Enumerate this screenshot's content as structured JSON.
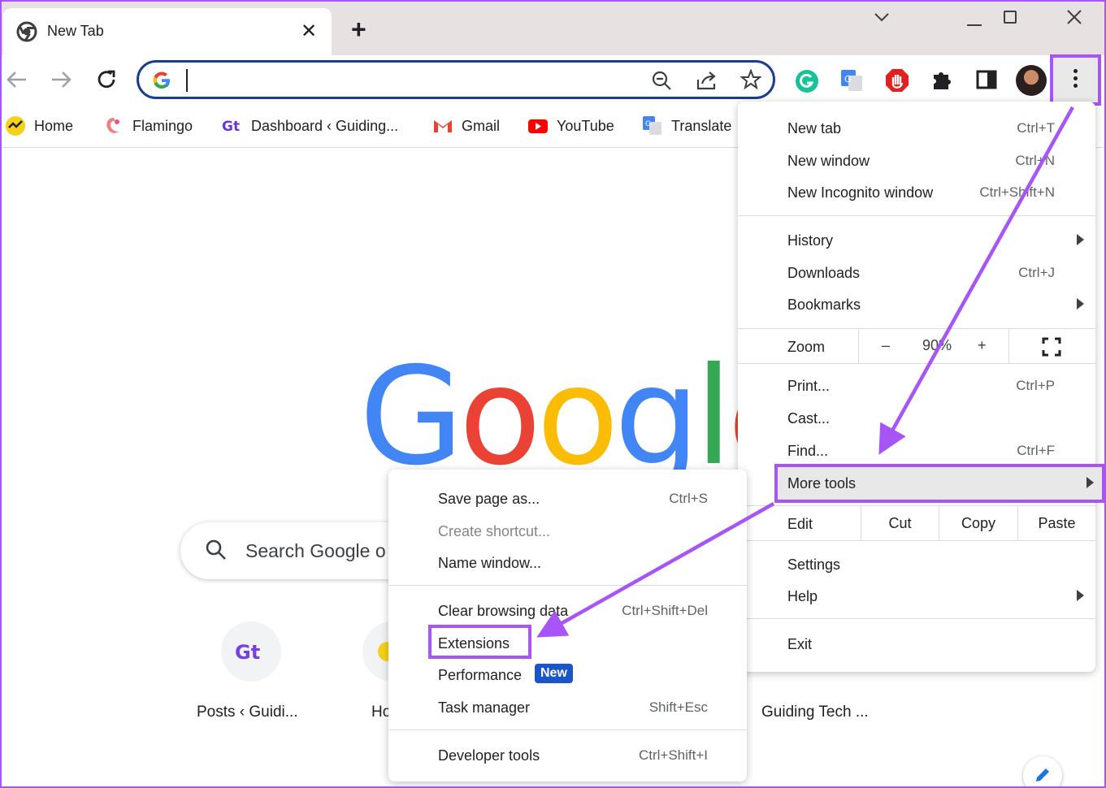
{
  "tab": {
    "title": "New Tab"
  },
  "bookmarks": [
    {
      "label": "Home"
    },
    {
      "label": "Flamingo"
    },
    {
      "label": "Dashboard ‹ Guiding..."
    },
    {
      "label": "Gmail"
    },
    {
      "label": "YouTube"
    },
    {
      "label": "Translate"
    }
  ],
  "search": {
    "placeholder": "Search Google o"
  },
  "logo": {
    "text": "Google"
  },
  "shortcuts": [
    {
      "label": "Posts ‹ Guidi..."
    },
    {
      "label": "Ho"
    },
    {
      "label": "Guiding Tech ..."
    }
  ],
  "main_menu": {
    "new_tab": {
      "label": "New tab",
      "shortcut": "Ctrl+T"
    },
    "new_window": {
      "label": "New window",
      "shortcut": "Ctrl+N"
    },
    "new_incognito": {
      "label": "New Incognito window",
      "shortcut": "Ctrl+Shift+N"
    },
    "history": {
      "label": "History"
    },
    "downloads": {
      "label": "Downloads",
      "shortcut": "Ctrl+J"
    },
    "bookmarks": {
      "label": "Bookmarks"
    },
    "zoom": {
      "label": "Zoom",
      "minus": "–",
      "value": "90%",
      "plus": "+"
    },
    "print": {
      "label": "Print...",
      "shortcut": "Ctrl+P"
    },
    "cast": {
      "label": "Cast..."
    },
    "find": {
      "label": "Find...",
      "shortcut": "Ctrl+F"
    },
    "more_tools": {
      "label": "More tools"
    },
    "edit": {
      "label": "Edit",
      "cut": "Cut",
      "copy": "Copy",
      "paste": "Paste"
    },
    "settings": {
      "label": "Settings"
    },
    "help": {
      "label": "Help"
    },
    "exit": {
      "label": "Exit"
    }
  },
  "sub_menu": {
    "save_page": {
      "label": "Save page as...",
      "shortcut": "Ctrl+S"
    },
    "create_shortcut": {
      "label": "Create shortcut..."
    },
    "name_window": {
      "label": "Name window..."
    },
    "clear_browsing": {
      "label": "Clear browsing data",
      "shortcut": "Ctrl+Shift+Del"
    },
    "extensions": {
      "label": "Extensions"
    },
    "performance": {
      "label": "Performance",
      "badge": "New"
    },
    "task_manager": {
      "label": "Task manager",
      "shortcut": "Shift+Esc"
    },
    "developer_tools": {
      "label": "Developer tools",
      "shortcut": "Ctrl+Shift+I"
    }
  },
  "colors": {
    "highlight": "#a855f7",
    "omnibox_border": "#1a3d8f",
    "badge": "#1a56c8"
  }
}
